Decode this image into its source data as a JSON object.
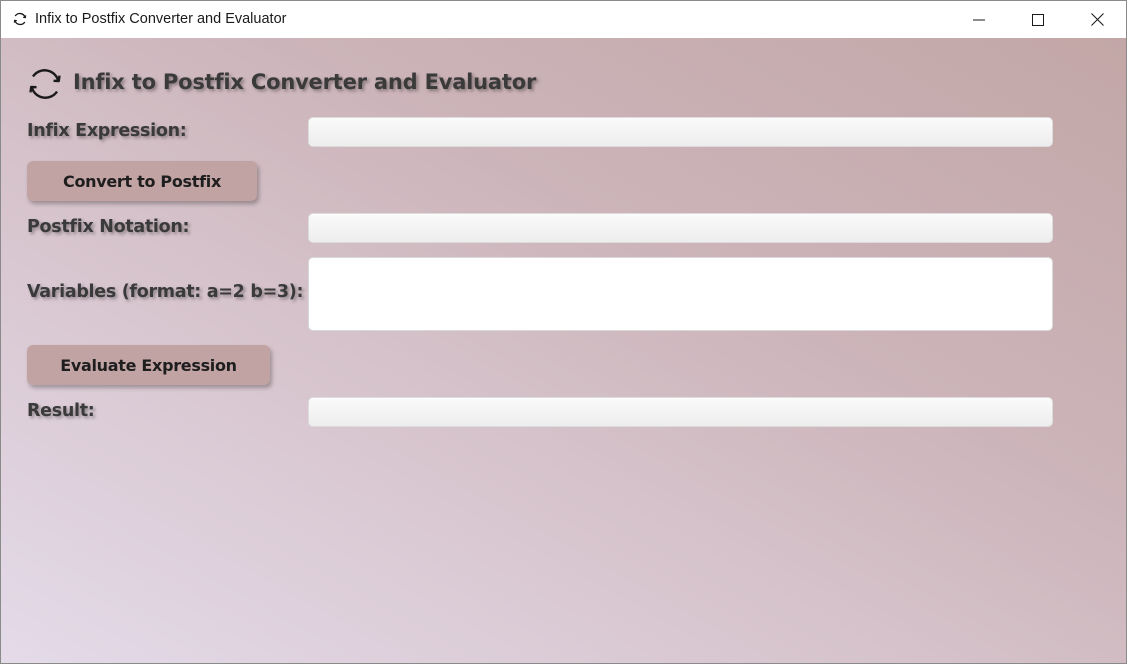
{
  "window": {
    "title": "Infix to Postfix Converter and Evaluator",
    "icon": "refresh-icon",
    "controls": [
      "minimize-icon",
      "maximize-icon",
      "close-icon"
    ]
  },
  "header": {
    "icon": "refresh-icon",
    "title": "Infix to Postfix Converter and Evaluator"
  },
  "form": {
    "infix_label": "Infix Expression:",
    "infix_value": "",
    "convert_button": "Convert to Postfix",
    "postfix_label": "Postfix Notation:",
    "postfix_value": "",
    "variables_label": "Variables (format: a=2 b=3):",
    "variables_value": "",
    "evaluate_button": "Evaluate Expression",
    "result_label": "Result:",
    "result_value": ""
  },
  "colors": {
    "gradient_start": "#e4dbe9",
    "gradient_end": "#c3a7a7",
    "button_bg": "#c2a3a3",
    "label_text": "#3a3a3a"
  }
}
